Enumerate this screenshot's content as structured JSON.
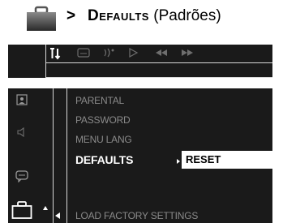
{
  "heading": {
    "arrow": ">",
    "title_smallcaps": "Defaults",
    "title_paren": " (Padrões)",
    "icon": "toolbox-icon"
  },
  "top_bar": {
    "icons": [
      "settings-tools-icon",
      "subtitle-icon",
      "audio-icon",
      "play-icon",
      "rewind-icon",
      "fast-forward-icon"
    ]
  },
  "sidebar": {
    "icons": [
      "parental-icon",
      "speaker-icon",
      "chat-icon",
      "toolbox-icon"
    ]
  },
  "menu": {
    "items": [
      {
        "label": "Parental",
        "active": false
      },
      {
        "label": "Password",
        "active": false
      },
      {
        "label": "Menu Lang",
        "active": false
      },
      {
        "label": "Defaults",
        "active": true
      },
      {
        "label": "Load Factory Settings",
        "active": false
      }
    ],
    "reset_option": "RESET"
  },
  "colors": {
    "screen_bg": "#1a1a1a",
    "inactive_text": "#8a8a8a",
    "active_text": "#ffffff",
    "frame_line": "#d8d8d8"
  }
}
